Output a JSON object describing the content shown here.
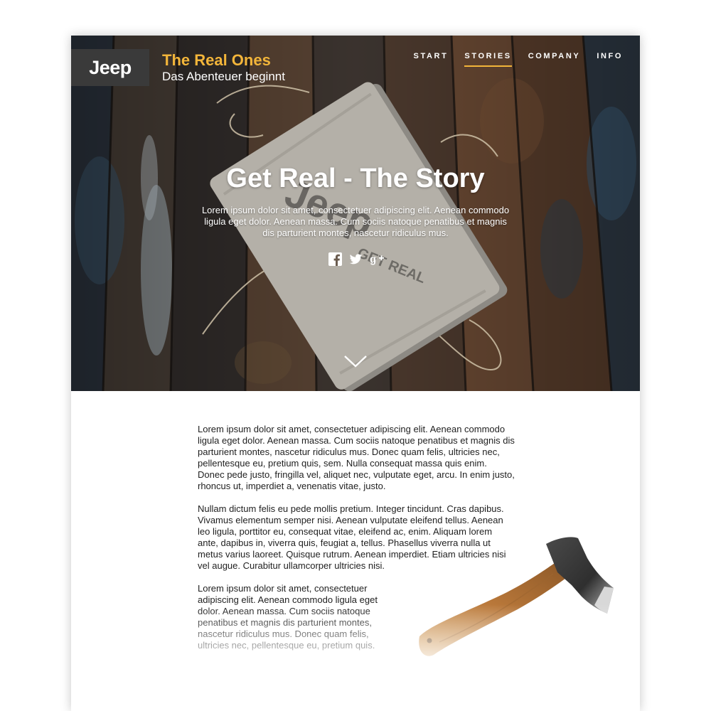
{
  "brand": {
    "logo_text": "Jeep",
    "title": "The Real Ones",
    "subtitle": "Das Abenteuer beginnt"
  },
  "nav": {
    "items": [
      {
        "label": "START"
      },
      {
        "label": "STORIES",
        "active": true
      },
      {
        "label": "COMPANY"
      },
      {
        "label": "INFO"
      }
    ]
  },
  "hero": {
    "title": "Get Real - The Story",
    "text": "Lorem ipsum dolor sit amet, consectetuer adipiscing elit. Aenean commodo ligula eget dolor. Aenean massa. Cum sociis natoque penatibus et magnis dis parturient montes, nascetur ridiculus mus.",
    "package_print_1": "Jeep",
    "package_print_2": "GET REAL",
    "social_icons": [
      "facebook-icon",
      "twitter-icon",
      "google-plus-icon"
    ],
    "scroll_icon": "chevron-down-icon"
  },
  "article": {
    "paragraphs": [
      "Lorem ipsum dolor sit amet, consectetuer adipiscing elit. Aenean commodo ligula eget dolor. Aenean massa. Cum sociis natoque penatibus et magnis dis parturient montes, nascetur ridiculus mus. Donec quam felis, ultricies nec, pellentesque eu, pretium quis, sem. Nulla consequat massa quis enim. Donec pede justo, fringilla vel, aliquet nec, vulputate eget, arcu. In enim justo, rhoncus ut, imperdiet a, venenatis vitae, justo.",
      "Nullam dictum felis eu pede mollis pretium. Integer tincidunt. Cras dapibus. Vivamus elementum semper nisi. Aenean vulputate eleifend tellus. Aenean leo ligula, porttitor eu, consequat vitae, eleifend ac, enim. Aliquam lorem ante, dapibus in, viverra quis, feugiat a, tellus. Phasellus viverra nulla ut metus varius laoreet. Quisque rutrum. Aenean imperdiet. Etiam ultricies nisi vel augue. Curabitur ullamcorper ultricies nisi.",
      "Lorem ipsum dolor sit amet, consectetuer adipiscing elit. Aenean commodo ligula eget dolor. Aenean massa. Cum sociis natoque penatibus et magnis dis parturient montes, nascetur ridiculus mus. Donec quam felis, ultricies nec, pellentesque eu, pretium quis."
    ]
  },
  "colors": {
    "accent": "#f2b53a",
    "logo_bg": "#3a3a3a",
    "text": "#1f1f1f"
  }
}
